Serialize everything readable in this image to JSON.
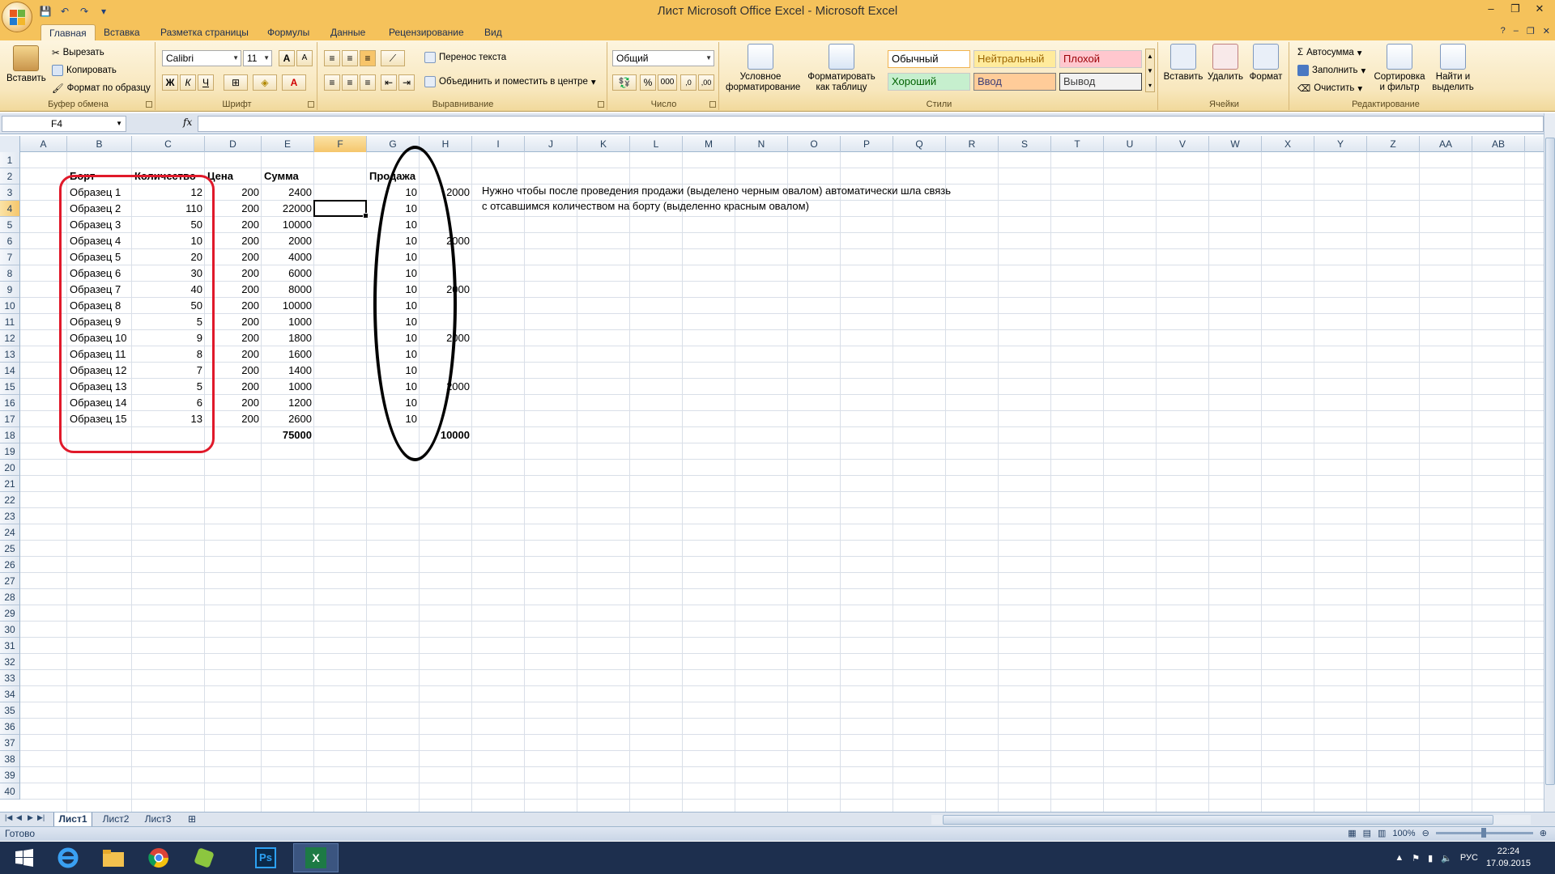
{
  "window": {
    "title": "Лист Microsoft Office Excel - Microsoft Excel",
    "controls": [
      "–",
      "❐",
      "✕"
    ],
    "doc_controls": [
      "–",
      "❐",
      "✕"
    ]
  },
  "ribbon_tabs": [
    "Главная",
    "Вставка",
    "Разметка страницы",
    "Формулы",
    "Данные",
    "Рецензирование",
    "Вид"
  ],
  "ribbon": {
    "clipboard": {
      "label": "Буфер обмена",
      "paste": "Вставить",
      "cut": "Вырезать",
      "copy": "Копировать",
      "format_painter": "Формат по образцу"
    },
    "font": {
      "label": "Шрифт",
      "font_name": "Calibri",
      "font_size": "11",
      "bold": "Ж",
      "italic": "К",
      "underline": "Ч"
    },
    "alignment": {
      "label": "Выравнивание",
      "wrap": "Перенос текста",
      "merge": "Объединить и поместить в центре"
    },
    "number": {
      "label": "Число",
      "format": "Общий",
      "percent": "%",
      "thousands": "000"
    },
    "styles": {
      "label": "Стили",
      "conditional": "Условное форматирование",
      "as_table": "Форматировать как таблицу",
      "normal": "Обычный",
      "neutral": "Нейтральный",
      "bad": "Плохой",
      "good": "Хороший",
      "input": "Ввод",
      "output": "Вывод"
    },
    "cells": {
      "label": "Ячейки",
      "insert": "Вставить",
      "delete": "Удалить",
      "format": "Формат"
    },
    "editing": {
      "label": "Редактирование",
      "autosum": "Автосумма",
      "fill": "Заполнить",
      "clear": "Очистить",
      "sort": "Сортировка и фильтр",
      "find": "Найти и выделить"
    }
  },
  "formula_bar": {
    "name_box": "F4",
    "fx": "fx",
    "formula": ""
  },
  "columns": [
    "A",
    "B",
    "C",
    "D",
    "E",
    "F",
    "G",
    "H",
    "I",
    "J",
    "K",
    "L",
    "M",
    "N",
    "O",
    "P",
    "Q",
    "R",
    "S",
    "T",
    "U",
    "V",
    "W",
    "X",
    "Y",
    "Z",
    "AA",
    "AB",
    "AC"
  ],
  "selected_column": "F",
  "selected_row": 4,
  "rows_visible": 40,
  "headers": {
    "b": "Борт",
    "c": "Количество",
    "d": "Цена",
    "e": "Сумма",
    "g": "Продажа"
  },
  "table": [
    {
      "b": "Образец 1",
      "c": "12",
      "d": "200",
      "e": "2400",
      "g": "10",
      "h": "2000"
    },
    {
      "b": "Образец 2",
      "c": "110",
      "d": "200",
      "e": "22000",
      "g": "10",
      "h": ""
    },
    {
      "b": "Образец 3",
      "c": "50",
      "d": "200",
      "e": "10000",
      "g": "10",
      "h": ""
    },
    {
      "b": "Образец 4",
      "c": "10",
      "d": "200",
      "e": "2000",
      "g": "10",
      "h": "2000"
    },
    {
      "b": "Образец 5",
      "c": "20",
      "d": "200",
      "e": "4000",
      "g": "10",
      "h": ""
    },
    {
      "b": "Образец 6",
      "c": "30",
      "d": "200",
      "e": "6000",
      "g": "10",
      "h": ""
    },
    {
      "b": "Образец 7",
      "c": "40",
      "d": "200",
      "e": "8000",
      "g": "10",
      "h": "2000"
    },
    {
      "b": "Образец 8",
      "c": "50",
      "d": "200",
      "e": "10000",
      "g": "10",
      "h": ""
    },
    {
      "b": "Образец 9",
      "c": "5",
      "d": "200",
      "e": "1000",
      "g": "10",
      "h": ""
    },
    {
      "b": "Образец 10",
      "c": "9",
      "d": "200",
      "e": "1800",
      "g": "10",
      "h": "2000"
    },
    {
      "b": "Образец 11",
      "c": "8",
      "d": "200",
      "e": "1600",
      "g": "10",
      "h": ""
    },
    {
      "b": "Образец 12",
      "c": "7",
      "d": "200",
      "e": "1400",
      "g": "10",
      "h": ""
    },
    {
      "b": "Образец 13",
      "c": "5",
      "d": "200",
      "e": "1000",
      "g": "10",
      "h": "2000"
    },
    {
      "b": "Образец 14",
      "c": "6",
      "d": "200",
      "e": "1200",
      "g": "10",
      "h": ""
    },
    {
      "b": "Образец 15",
      "c": "13",
      "d": "200",
      "e": "2600",
      "g": "10",
      "h": ""
    }
  ],
  "totals": {
    "e": "75000",
    "h": "10000"
  },
  "note": {
    "line1": "Нужно чтобы после проведения продажи (выделено черным овалом) автоматически шла связь",
    "line2": "с отсавшимся количеством на борту (выделенно красным овалом)"
  },
  "colors": {
    "red_oval": "#e0192a",
    "black_oval": "#000000",
    "title_bar": "#f5c25b"
  },
  "sheets": [
    "Лист1",
    "Лист2",
    "Лист3"
  ],
  "active_sheet": "Лист1",
  "status": {
    "text": "Готово",
    "zoom": "100%"
  },
  "taskbar": {
    "apps": [
      "windows-start-icon",
      "internet-explorer-icon",
      "file-explorer-icon",
      "chrome-icon",
      "app-icon",
      "photoshop-icon",
      "excel-icon"
    ],
    "ps_label": "Ps",
    "lang": "РУС",
    "time": "22:24",
    "date": "17.09.2015"
  }
}
